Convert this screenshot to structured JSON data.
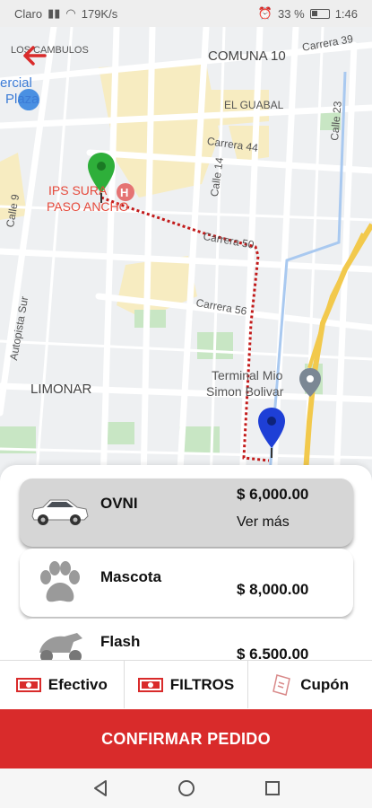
{
  "status_bar": {
    "carrier": "Claro",
    "speed": "179K/s",
    "battery": "33 %",
    "time": "1:46"
  },
  "map": {
    "labels": {
      "los_cambulos": "LOS CAMBULOS",
      "carrera_39": "Carrera 39",
      "comuna_10": "COMUNA 10",
      "mercial": "ercial",
      "plaza": "Plaza",
      "el_guabal": "EL GUABAL",
      "calle_23": "Calle 23",
      "carrera_44": "Carrera 44",
      "calle_9": "Calle 9",
      "calle_14": "Calle 14",
      "ips_line1": "IPS SURA",
      "ips_line2": "PASO ANCHO",
      "carrera_50": "Carrera 50",
      "carrera_56": "Carrera 56",
      "autopista_sur": "Autopista Sur",
      "terminal_line1": "Terminal Mio",
      "terminal_line2": "Simon Bolivar",
      "limonar": "LIMONAR"
    },
    "colors": {
      "route": "#c21a1a",
      "origin_pin": "#2eaf3a",
      "destination_pin": "#1e3fd6"
    }
  },
  "services": [
    {
      "name": "OVNI",
      "price": "$ 6,000.00",
      "more": "Ver más",
      "icon": "car-icon",
      "selected": true
    },
    {
      "name": "Mascota",
      "price": "$ 8,000.00",
      "icon": "paw-icon",
      "selected": false
    },
    {
      "name": "Flash",
      "price": "$ 6.500.00",
      "icon": "motorcycle-icon",
      "selected": false
    }
  ],
  "payment_bar": {
    "cash": "Efectivo",
    "filters": "FILTROS",
    "coupon": "Cupón"
  },
  "confirm_label": "CONFIRMAR PEDIDO"
}
